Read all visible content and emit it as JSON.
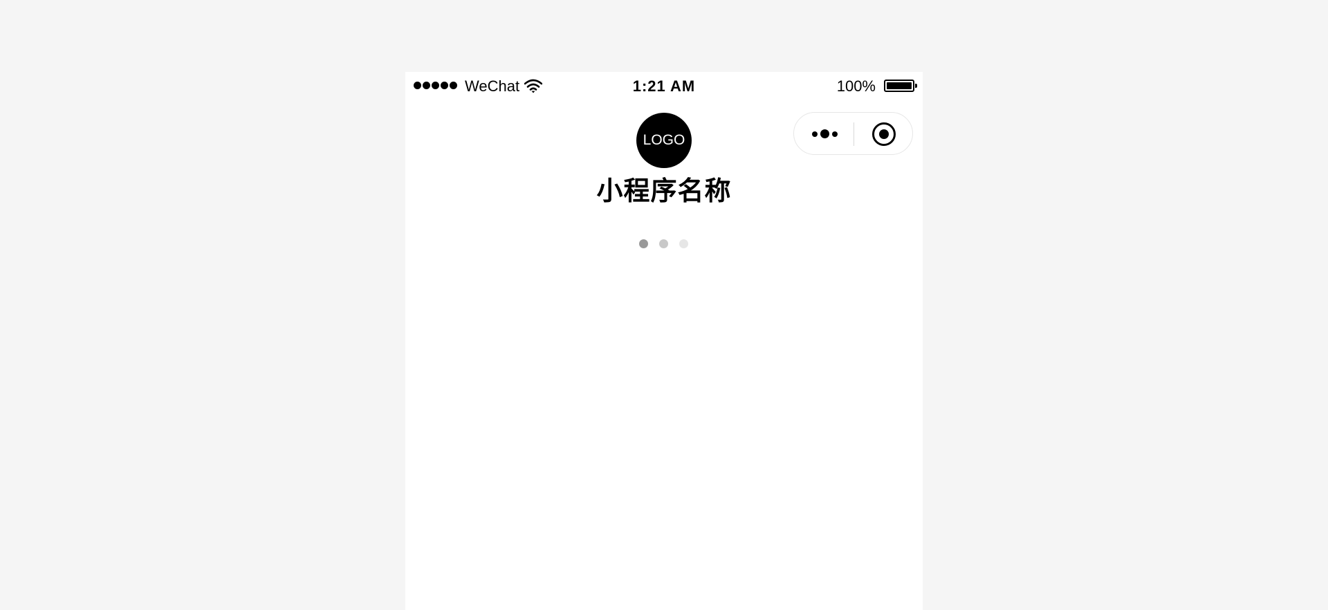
{
  "status_bar": {
    "carrier": "WeChat",
    "time": "1:21 AM",
    "battery_percent": "100%",
    "signal_bars": 5,
    "icons": [
      "signal-icon",
      "wifi-icon",
      "battery-icon"
    ]
  },
  "capsule": {
    "icons": [
      "more-icon",
      "close-mini-program-icon"
    ]
  },
  "app": {
    "logo_text": "LOGO",
    "name": "小程序名称"
  },
  "loading_dots": {
    "colors": [
      "#999999",
      "#c8c8c8",
      "#e6e6e6"
    ]
  },
  "colors": {
    "background": "#f5f5f5",
    "page": "#ffffff",
    "text": "#000000"
  }
}
